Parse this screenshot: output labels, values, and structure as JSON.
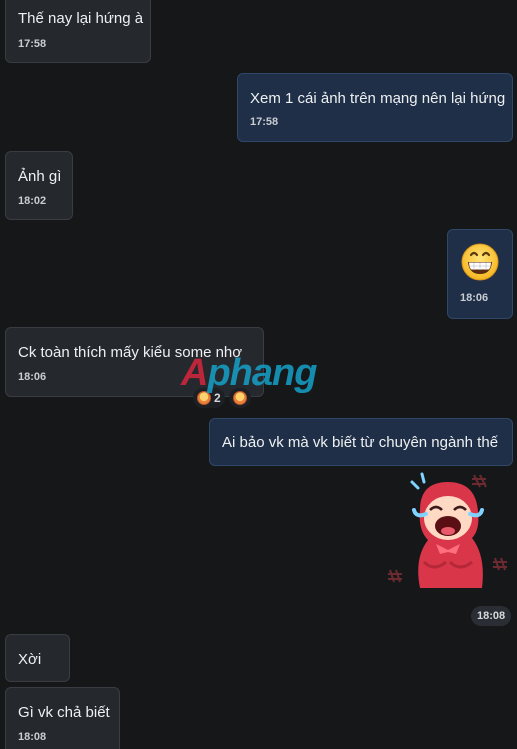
{
  "messages": [
    {
      "id": "m1",
      "direction": "in",
      "text": "Thế nay lại hứng à",
      "time": "17:58"
    },
    {
      "id": "m2",
      "direction": "out",
      "text": "Xem 1 cái ảnh trên mạng nên lại hứng",
      "time": "17:58"
    },
    {
      "id": "m3",
      "direction": "in",
      "text": "Ảnh gì",
      "time": "18:02"
    },
    {
      "id": "m4",
      "direction": "out",
      "emoji": "grinning-face",
      "time": "18:06"
    },
    {
      "id": "m5",
      "direction": "in",
      "text": "Ck toàn thích mấy kiểu some nhợ",
      "time": "18:06",
      "reactions": [
        {
          "icon": "face-reaction-icon",
          "count": "2"
        },
        {
          "icon": "face-reaction-icon",
          "count": ""
        }
      ]
    },
    {
      "id": "m6",
      "direction": "out",
      "text": "Ai bảo vk mà vk biết từ chuyên ngành thế"
    },
    {
      "id": "m7",
      "direction": "out",
      "sticker": "laughing-crying-red-hood-sticker",
      "time": "18:08"
    },
    {
      "id": "m8",
      "direction": "in",
      "text": "Xời"
    },
    {
      "id": "m9",
      "direction": "in",
      "text": "Gì vk chả biết",
      "time": "18:08"
    }
  ],
  "watermark": {
    "prefix": "A",
    "rest": "phang"
  },
  "colors": {
    "background": "#151719",
    "incoming_bubble": "#25282d",
    "outgoing_bubble": "#1e2f47",
    "text": "#eef0f2"
  }
}
